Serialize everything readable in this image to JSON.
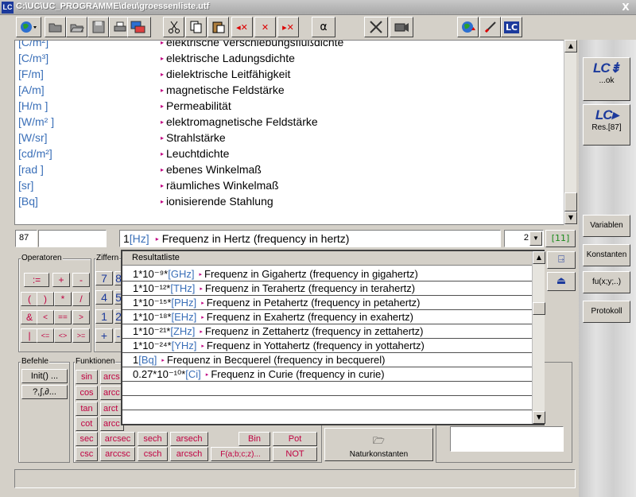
{
  "window": {
    "title": "C:\\UC\\UC_PROGRAMME\\deu\\groessenliste.utf",
    "app_icon": "LC",
    "close": "X"
  },
  "toolbar": {
    "icons": [
      "globe-dropdown-icon",
      "open-folder-icon",
      "open-file-icon",
      "save-disk-icon",
      "print-icon",
      "screen-config-icon",
      "cut-icon",
      "copy-icon",
      "paste-icon",
      "delete-left-icon",
      "delete-middle-icon",
      "delete-right-icon",
      "alpha-icon",
      "tools-icon",
      "camera-icon",
      "globe-alert-icon",
      "pen-icon",
      "lc-logo-icon"
    ],
    "alpha": "α"
  },
  "list": {
    "rows": [
      {
        "unit": "[C/m²]",
        "desc": "elektrische Verschiebungsflußdichte"
      },
      {
        "unit": "[C/m³]",
        "desc": "elektrische Ladungsdichte"
      },
      {
        "unit": "[F/m]",
        "desc": "dielektrische Leitfähigkeit"
      },
      {
        "unit": "[A/m]",
        "desc": "magnetische Feldstärke"
      },
      {
        "unit": "[H/m ]",
        "desc": "Permeabilität"
      },
      {
        "unit": "[W/m² ]",
        "desc": "elektromagnetische Feldstärke"
      },
      {
        "unit": "[W/sr]",
        "desc": "Strahlstärke"
      },
      {
        "unit": "[cd/m²]",
        "desc": "Leuchtdichte"
      },
      {
        "unit": "[rad ]",
        "desc": "ebenes Winkelmaß"
      },
      {
        "unit": "[sr]",
        "desc": "räumliches Winkelmaß"
      },
      {
        "unit": "[Bq]",
        "desc": "ionisierende Stahlung"
      }
    ]
  },
  "inputs": {
    "count": "87",
    "empty": "",
    "factor": "1",
    "unit": "[Hz]",
    "desc": "Frequenz in Hertz (frequency in hertz)",
    "precision": "2",
    "result_count": "[11]"
  },
  "right": {
    "ok_label": "...ok",
    "res_label": "Res.[87]",
    "variablen": "Variablen",
    "konstanten": "Konstanten",
    "function": "fu(x;y;..)",
    "protokoll": "Protokoll"
  },
  "operators": {
    "label": "Operatoren",
    "keys": [
      ":=",
      "+",
      "-",
      "(",
      ")",
      "*",
      "/",
      "&",
      "<",
      "==",
      ">",
      "|",
      "<=",
      "<>",
      ">="
    ]
  },
  "ziffern": {
    "label": "Ziffern",
    "keys": [
      "7",
      "8",
      "4",
      "5",
      "1",
      "2",
      "+",
      "-"
    ]
  },
  "befehle": {
    "label": "Befehle",
    "init": "Init() ...",
    "integral": "?,∫,∂..."
  },
  "funktionen": {
    "label": "Funktionen",
    "col1": [
      "sin",
      "cos",
      "tan",
      "cot",
      "sec",
      "csc"
    ],
    "col2": [
      "arcs",
      "arcc",
      "arct",
      "arcc",
      "arcsec",
      "arccsc"
    ],
    "sech": "sech",
    "arsech": "arsech",
    "csch": "csch",
    "arcsch": "arcsch",
    "bin": "Bin",
    "pot": "Pot",
    "fabc": "F(a;b;c;z)...",
    "not": "NOT"
  },
  "naturkonstanten": "Naturkonstanten",
  "popup": {
    "header": "Resultatliste",
    "rows": [
      {
        "factor": "1*10⁻⁹*",
        "unit": "[GHz]",
        "desc": "Frequenz in Gigahertz (frequency in gigahertz)"
      },
      {
        "factor": "1*10⁻¹²*",
        "unit": "[THz]",
        "desc": "Frequenz in Terahertz (frequency in terahertz)"
      },
      {
        "factor": "1*10⁻¹⁵*",
        "unit": "[PHz]",
        "desc": "Frequenz in Petahertz (frequency in petahertz)"
      },
      {
        "factor": "1*10⁻¹⁸*",
        "unit": "[EHz]",
        "desc": "Frequenz in Exahertz (frequency in exahertz)"
      },
      {
        "factor": "1*10⁻²¹*",
        "unit": "[ZHz]",
        "desc": "Frequenz in Zettahertz (frequency in zettahertz)"
      },
      {
        "factor": "1*10⁻²⁴*",
        "unit": "[YHz]",
        "desc": "Frequenz in Yottahertz (frequency in yottahertz)"
      },
      {
        "factor": "1",
        "unit": "[Bq]",
        "desc": "Frequenz in Becquerel (frequency in becquerel)"
      },
      {
        "factor": "0.27*10⁻¹⁰*",
        "unit": "[Ci]",
        "desc": "Frequenz in Curie (frequency in curie)"
      }
    ]
  }
}
